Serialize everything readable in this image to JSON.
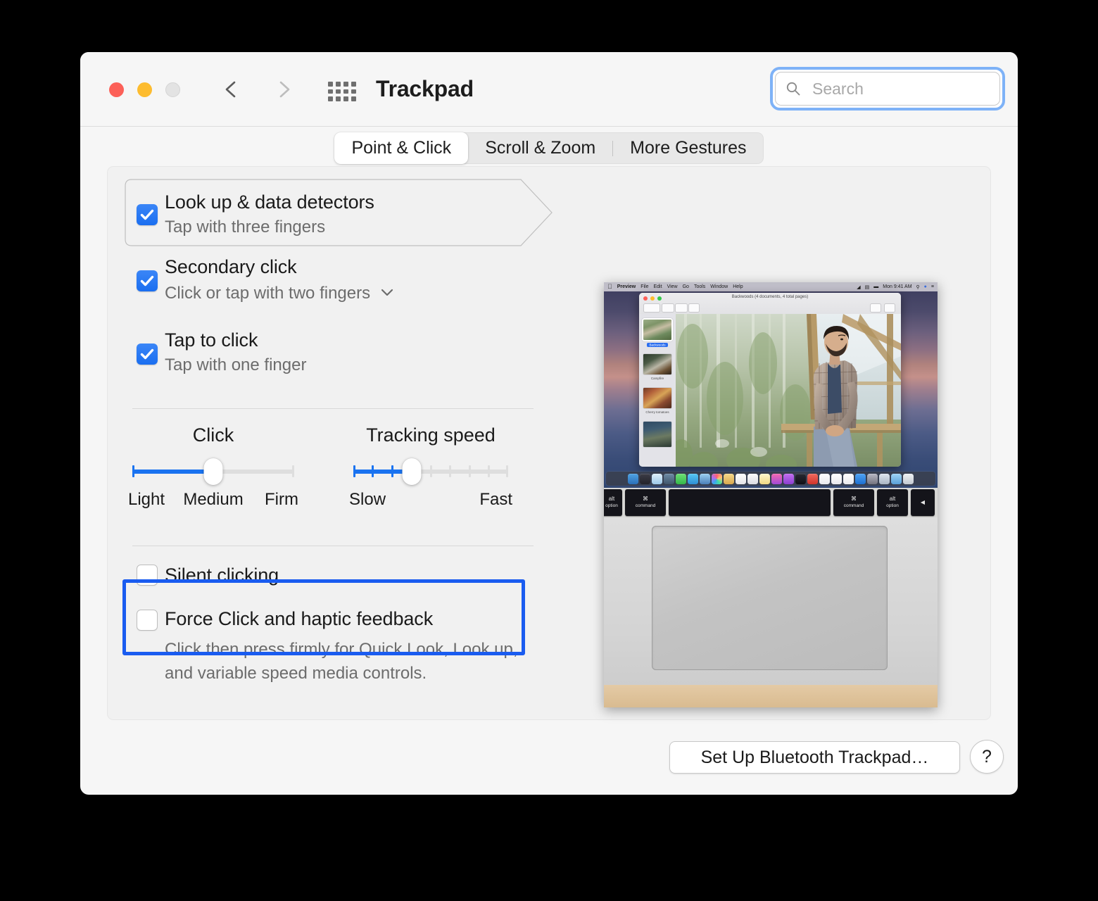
{
  "window": {
    "title": "Trackpad",
    "traffic_lights": [
      "close",
      "minimize",
      "zoom"
    ],
    "nav_back_icon": "chevron-left-icon",
    "nav_forward_icon": "chevron-right-icon",
    "grid_icon": "show-all-grid-icon"
  },
  "search": {
    "placeholder": "Search",
    "value": "",
    "icon": "search-icon",
    "focused": true,
    "focus_ring_color": "#7eb2f7"
  },
  "tabs": [
    {
      "label": "Point & Click",
      "active": true
    },
    {
      "label": "Scroll & Zoom",
      "active": false
    },
    {
      "label": "More Gestures",
      "active": false
    }
  ],
  "options": [
    {
      "title": "Look up & data detectors",
      "subtitle": "Tap with three fingers",
      "checked": true,
      "has_popup": false,
      "highlighted_tag": true
    },
    {
      "title": "Secondary click",
      "subtitle": "Click or tap with two fingers",
      "checked": true,
      "has_popup": true,
      "popup_icon": "chevron-down-icon",
      "highlighted_tag": false
    },
    {
      "title": "Tap to click",
      "subtitle": "Tap with one finger",
      "checked": true,
      "has_popup": false,
      "highlighted_tag": false
    }
  ],
  "sliders": [
    {
      "name": "click",
      "label": "Click",
      "min_label": "Light",
      "mid_label": "Medium",
      "max_label": "Firm",
      "ticks": 3,
      "value_index": 1,
      "fill_color": "#1a73f0"
    },
    {
      "name": "tracking-speed",
      "label": "Tracking speed",
      "min_label": "Slow",
      "max_label": "Fast",
      "ticks": 9,
      "value_index": 3,
      "fill_color": "#1a73f0"
    }
  ],
  "checkboxes": [
    {
      "label": "Silent clicking",
      "checked": false,
      "description": "",
      "highlighted": false
    },
    {
      "label": "Force Click and haptic feedback",
      "checked": false,
      "description_line1": "Click then press firmly for Quick Look, Look up,",
      "description_line2": "and variable speed media controls.",
      "highlighted": true,
      "highlight_color": "#1a5cf0"
    }
  ],
  "footer": {
    "setup_button": "Set Up Bluetooth Trackpad…",
    "help_button": "?"
  },
  "preview_video": {
    "menubar": {
      "apple": "",
      "app_name": "Preview",
      "menus": [
        "File",
        "Edit",
        "View",
        "Go",
        "Tools",
        "Window",
        "Help"
      ],
      "clock": "Mon 9:41 AM",
      "right_icons": [
        "wifi-icon",
        "control-center-icon",
        "battery-icon",
        "spotlight-icon",
        "siri-icon",
        "menu-icon"
      ]
    },
    "app_window": {
      "title": "Backwoods (4 documents, 4 total pages)",
      "sidebar_items": [
        {
          "caption": "Backwoods",
          "selected": true
        },
        {
          "caption": "Campfire",
          "selected": false
        },
        {
          "caption": "Cherry tomatoes",
          "selected": false
        },
        {
          "caption": "",
          "selected": false
        }
      ]
    },
    "keyboard_keys": [
      {
        "top": "alt",
        "bottom": "option"
      },
      {
        "top": "⌘",
        "bottom": "command"
      },
      {
        "top": "",
        "bottom": ""
      },
      {
        "top": "⌘",
        "bottom": "command"
      },
      {
        "top": "alt",
        "bottom": "option"
      },
      {
        "top": "◀",
        "bottom": ""
      }
    ]
  },
  "colors": {
    "accent": "#1a73f0",
    "checkbox_blue": "#2b74f0",
    "window_bg": "#f6f6f6",
    "panel_bg": "#f1f1f1",
    "highlight_border": "#1a5cf0"
  }
}
